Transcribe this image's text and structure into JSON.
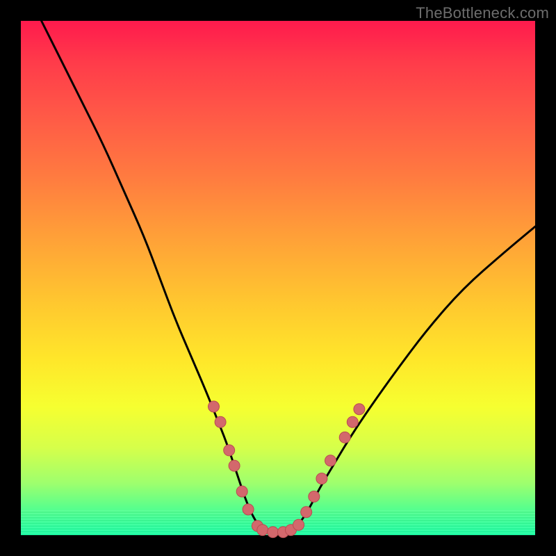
{
  "watermark": "TheBottleneck.com",
  "colors": {
    "frame_bg": "#000000",
    "curve_stroke": "#000000",
    "point_fill": "#d3686c",
    "point_stroke": "#b94c50",
    "gradient_top": "#ff1a4d",
    "gradient_bottom": "#1cffa5"
  },
  "chart_data": {
    "type": "line",
    "title": "",
    "xlabel": "",
    "ylabel": "",
    "xlim": [
      0,
      100
    ],
    "ylim": [
      0,
      100
    ],
    "grid": false,
    "description": "Bottleneck curve: percentage bottleneck (y, 0=ideal at bottom, 100=worst at top) vs. component balance position (x). Curve dips to ~0 between x≈44–55 (green zone), rises steeply on both sides. Highlighted sample points cluster on the walls of the dip near the low-bottleneck region.",
    "series": [
      {
        "name": "bottleneck-curve",
        "x": [
          4,
          8,
          12,
          16,
          20,
          24,
          27,
          30,
          33,
          36,
          38,
          40,
          42,
          44,
          46,
          48,
          50,
          52,
          54,
          56,
          58,
          61,
          64,
          68,
          73,
          79,
          86,
          94,
          100
        ],
        "y": [
          100,
          92,
          84,
          76,
          67,
          58,
          50,
          42,
          35,
          28,
          23,
          18,
          12,
          6,
          2,
          0.5,
          0,
          0.5,
          2,
          5,
          9,
          14,
          19,
          25,
          32,
          40,
          48,
          55,
          60
        ]
      }
    ],
    "points": [
      {
        "x": 37.5,
        "y": 25
      },
      {
        "x": 38.8,
        "y": 22
      },
      {
        "x": 40.5,
        "y": 16.5
      },
      {
        "x": 41.5,
        "y": 13.5
      },
      {
        "x": 43.0,
        "y": 8.5
      },
      {
        "x": 44.2,
        "y": 5.0
      },
      {
        "x": 46.0,
        "y": 1.8
      },
      {
        "x": 47.0,
        "y": 1.0
      },
      {
        "x": 49.0,
        "y": 0.6
      },
      {
        "x": 51.0,
        "y": 0.6
      },
      {
        "x": 52.5,
        "y": 1.0
      },
      {
        "x": 54.0,
        "y": 2.0
      },
      {
        "x": 55.5,
        "y": 4.5
      },
      {
        "x": 57.0,
        "y": 7.5
      },
      {
        "x": 58.5,
        "y": 11.0
      },
      {
        "x": 60.2,
        "y": 14.5
      },
      {
        "x": 63.0,
        "y": 19.0
      },
      {
        "x": 64.5,
        "y": 22.0
      },
      {
        "x": 65.8,
        "y": 24.5
      }
    ],
    "point_radius": 8
  }
}
